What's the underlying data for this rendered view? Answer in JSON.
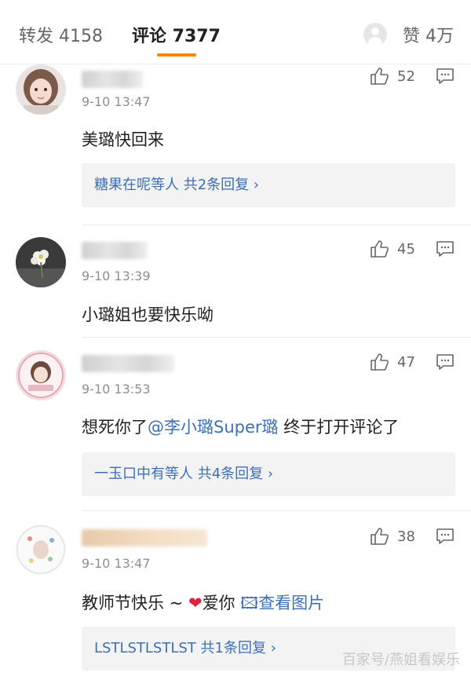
{
  "tabs": {
    "repost": "转发 4158",
    "comments": "评论 7377",
    "likes": "赞 4万"
  },
  "comments": [
    {
      "time": "9-10 13:47",
      "likes": "52",
      "text": "美璐快回来",
      "replies": "糖果在呢等人  共2条回复 ›"
    },
    {
      "time": "9-10 13:39",
      "likes": "45",
      "text": "小璐姐也要快乐呦"
    },
    {
      "time": "9-10 13:53",
      "likes": "47",
      "text_before": "想死你了",
      "mention": "@李小璐Super璐",
      "text_after": "  终于打开评论了",
      "replies": "一玉口中有等人  共4条回复 ›"
    },
    {
      "time": "9-10 13:47",
      "likes": "38",
      "text_before": "教师节快乐 ~ ",
      "heart": "❤",
      "text_after": "爱你 ",
      "picture_link": "🖾查看图片",
      "replies": "LSTLSTLSTLST  共1条回复 ›"
    }
  ],
  "watermark": "百家号/燕姐看娱乐"
}
